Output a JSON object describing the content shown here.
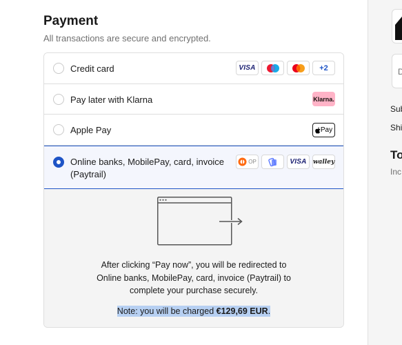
{
  "payment": {
    "title": "Payment",
    "subtitle": "All transactions are secure and encrypted.",
    "options": [
      {
        "label": "Credit card",
        "logos": [
          "VISA",
          "maestro",
          "mastercard",
          "+2"
        ]
      },
      {
        "label": "Pay later with Klarna",
        "logos": [
          "Klarna."
        ]
      },
      {
        "label": "Apple Pay",
        "logos": [
          "Pay"
        ]
      },
      {
        "label_line1": "Online banks, MobilePay, card, invoice",
        "label_line2": "(Paytrail)",
        "logos": [
          "OP",
          "MobilePay",
          "VISA",
          "walley"
        ],
        "selected": true
      }
    ],
    "detail": {
      "redirect_line1": "After clicking “Pay now”, you will be redirected to",
      "redirect_line2": "Online banks, MobilePay, card, invoice (Paytrail) to",
      "redirect_line3": "complete your purchase securely.",
      "charge_prefix": "Note: you will be charged ",
      "charge_amount": "€129,69 EUR",
      "charge_suffix": "."
    }
  },
  "sidebar": {
    "discount_placeholder": "D",
    "subtotal_label": "Sub",
    "shipping_label": "Shi",
    "total_label": "To",
    "taxes_note": "Inc"
  },
  "colors": {
    "accent": "#1e54c6",
    "selected_bg": "#f4f6fd",
    "highlight": "#b7d0f2"
  }
}
